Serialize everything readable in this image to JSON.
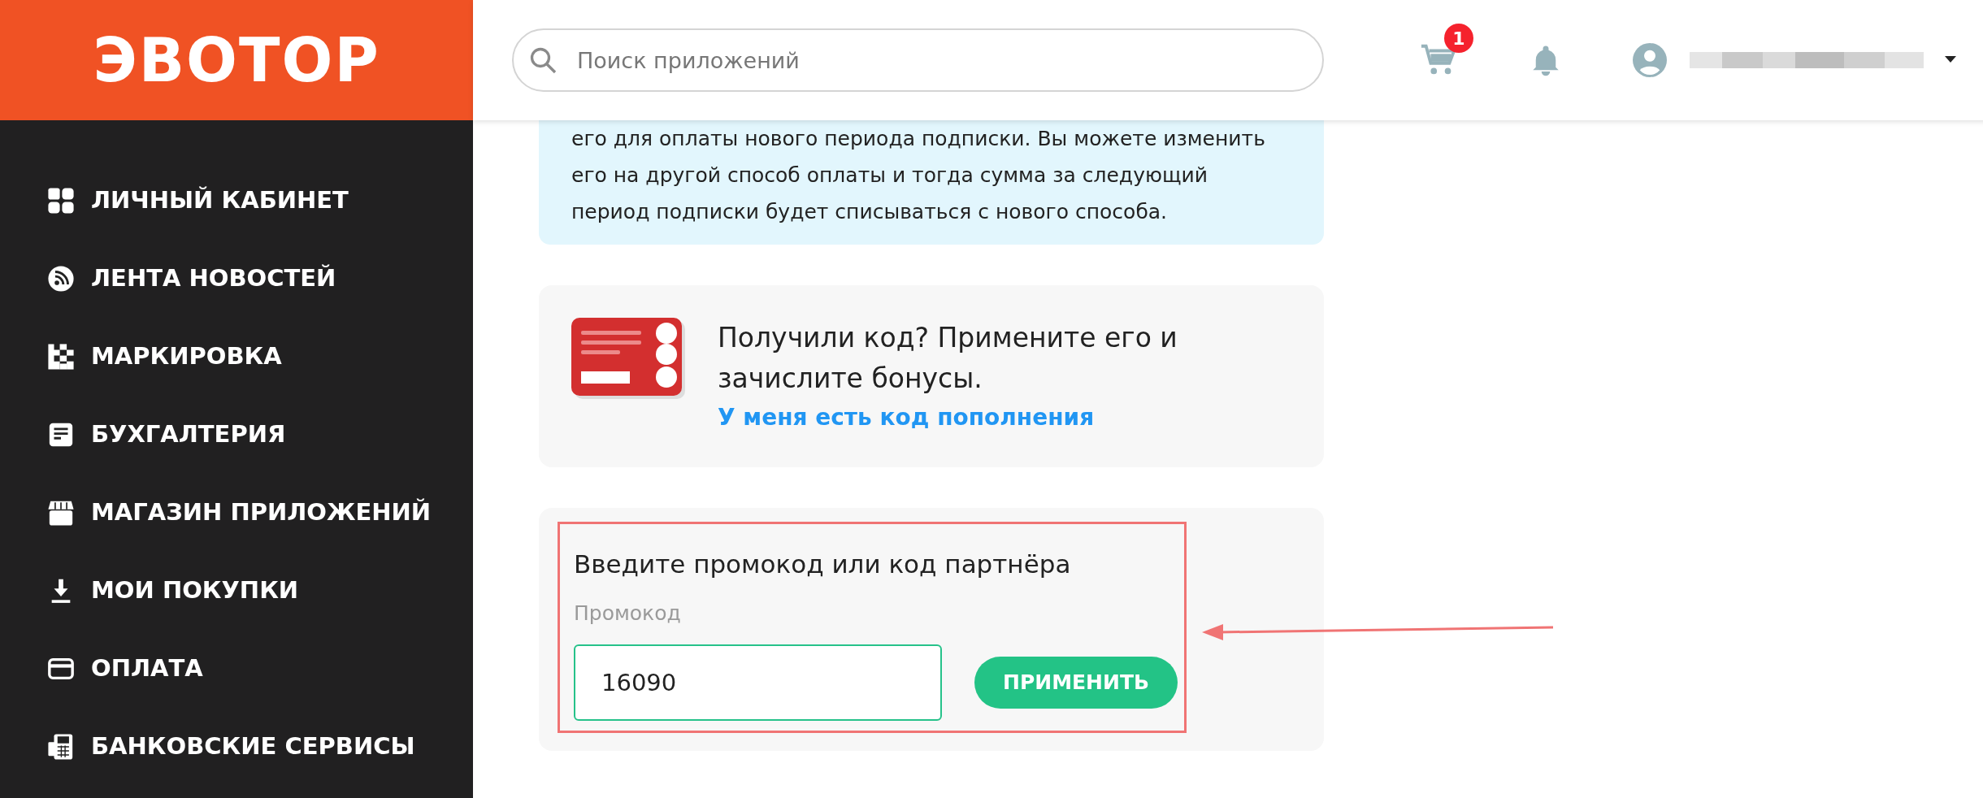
{
  "logo": {
    "text": "ЭВОТОР"
  },
  "sidebar": {
    "items": [
      {
        "label": "ЛИЧНЫЙ КАБИНЕТ"
      },
      {
        "label": "ЛЕНТА НОВОСТЕЙ"
      },
      {
        "label": "МАРКИРОВКА"
      },
      {
        "label": "БУХГАЛТЕРИЯ"
      },
      {
        "label": "МАГАЗИН ПРИЛОЖЕНИЙ"
      },
      {
        "label": "МОИ ПОКУПКИ"
      },
      {
        "label": "ОПЛАТА"
      },
      {
        "label": "БАНКОВСКИЕ СЕРВИСЫ"
      }
    ]
  },
  "header": {
    "search": {
      "placeholder": "Поиск приложений"
    },
    "cart_badge": "1"
  },
  "info_box": {
    "lines": [
      "его для оплаты нового периода подписки. Вы можете изменить",
      "его на другой способ оплаты и тогда сумма за следующий",
      "период подписки будет списываться с нового способа."
    ]
  },
  "code_card": {
    "text": "Получили код? Примените его и зачислите бонусы.",
    "link": "У меня есть код пополнения"
  },
  "promo_card": {
    "title": "Введите промокод или код партнёра",
    "field_label": "Промокод",
    "value": "16090",
    "button": "ПРИМЕНИТЬ",
    "highlighted": true
  }
}
